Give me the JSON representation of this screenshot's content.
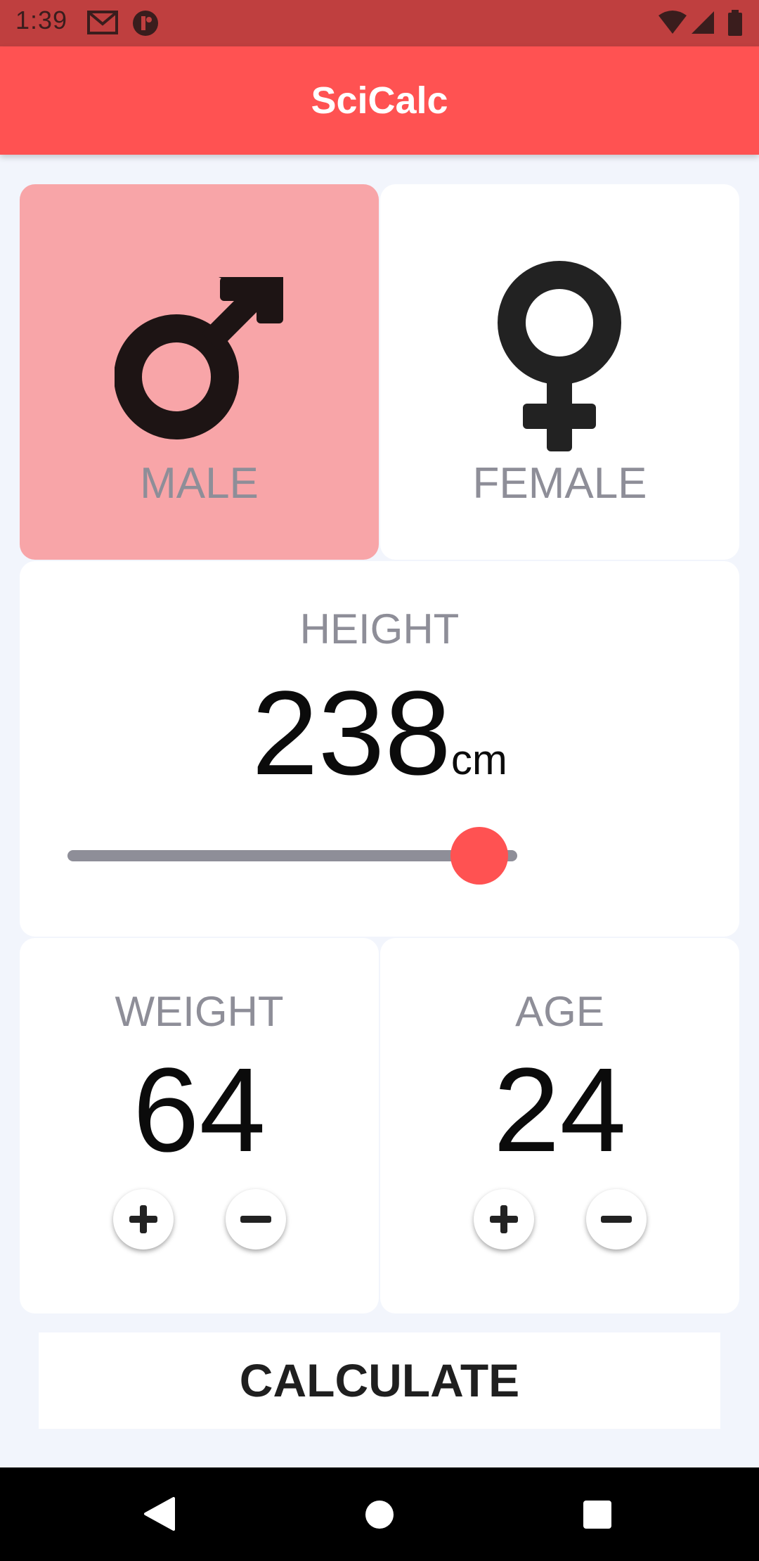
{
  "status_bar": {
    "time": "1:39",
    "icons": [
      "gmail-icon",
      "app-icon",
      "wifi-icon",
      "signal-icon",
      "battery-icon"
    ]
  },
  "app": {
    "title": "SciCalc"
  },
  "gender": {
    "male_label": "MALE",
    "female_label": "FEMALE",
    "selected": "male"
  },
  "height": {
    "label": "HEIGHT",
    "value": "238",
    "unit": "cm",
    "slider_fraction": 0.915
  },
  "weight": {
    "label": "WEIGHT",
    "value": "64"
  },
  "age": {
    "label": "AGE",
    "value": "24"
  },
  "calculate": {
    "label": "CALCULATE"
  },
  "colors": {
    "accent": "#FF5252",
    "selected_card": "#F8A5A8",
    "background": "#F2F5FC",
    "label_gray": "#8E8E98"
  }
}
